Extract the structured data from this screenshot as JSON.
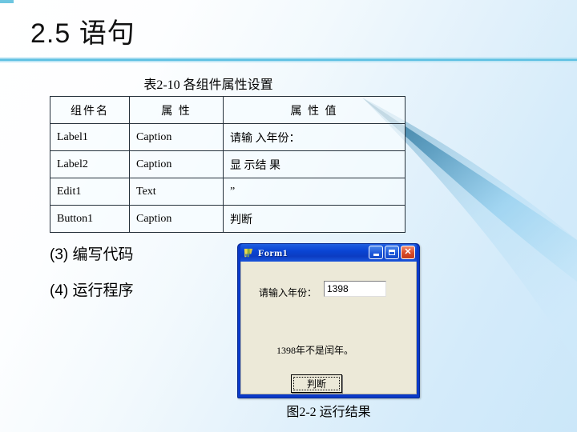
{
  "slide": {
    "title": "2.5  语句",
    "table_caption": "表2-10 各组件属性设置",
    "figure_caption": "图2-2 运行结果",
    "accent_color": "#6ec6e0",
    "divider_color": "#5cc0e2",
    "background_colors": [
      "#ffffff",
      "#cbe7f9"
    ]
  },
  "table": {
    "headers": [
      "组件名",
      "属 性",
      "属 性 值"
    ],
    "rows": [
      [
        "Label1",
        "Caption",
        "请输 入年份："
      ],
      [
        "Label2",
        "Caption",
        "显 示结 果"
      ],
      [
        "Edit1",
        "Text",
        "”"
      ],
      [
        "Button1",
        "Caption",
        "判断"
      ]
    ]
  },
  "bullets": [
    "(3) 编写代码",
    "(4) 运行程序"
  ],
  "form": {
    "title": "Form1",
    "icon": "vb-app-icon",
    "controls": {
      "minimize": "minimize-icon",
      "maximize": "restore-icon",
      "close": "✕"
    },
    "prompt_label": "请输入年份：",
    "input_value": "1398",
    "result_label": "1398年不是闰年。",
    "button_label": "判断",
    "titlebar_color": "#0a45d4",
    "body_color": "#ece9d8"
  }
}
